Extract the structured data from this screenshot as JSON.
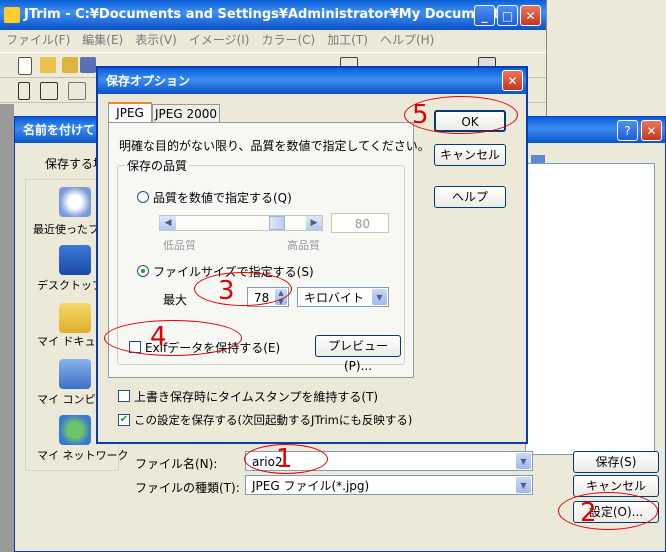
{
  "main_window": {
    "title": "JTrim - C:¥Documents and Settings¥Administrator¥My Document...",
    "menu": [
      "ファイル(F)",
      "編集(E)",
      "表示(V)",
      "イメージ(I)",
      "カラー(C)",
      "加工(T)",
      "ヘルプ(H)"
    ]
  },
  "save_as_dialog": {
    "title": "名前を付けて",
    "save_in_label": "保存する場",
    "places": [
      "最近使ったファ",
      "デスクトップ",
      "マイ ドキュメン",
      "マイ コンピュー",
      "マイ ネットワーク"
    ],
    "filename_label": "ファイル名(N):",
    "filename_value": "ario2",
    "filetype_label": "ファイルの種類(T):",
    "filetype_value": "JPEG ファイル(*.jpg)",
    "save_button": "保存(S)",
    "cancel_button": "キャンセル",
    "settings_button": "設定(O)..."
  },
  "options_dialog": {
    "title": "保存オプション",
    "tabs": [
      "JPEG",
      "JPEG 2000"
    ],
    "active_tab": "JPEG",
    "instruction": "明確な目的がない限り、品質を数値で指定してください。",
    "quality_group_label": "保存の品質",
    "radio_quality": "品質を数値で指定する(Q)",
    "quality_value": "80",
    "quality_slider_fraction": 0.8,
    "low_label": "低品質",
    "high_label": "高品質",
    "radio_filesize": "ファイルサイズで指定する(S)",
    "max_label": "最大",
    "max_value": "78",
    "unit_value": "キロバイト",
    "exif_label": "Exifデータを保持する(E)",
    "preview_button": "プレビュー(P)...",
    "timestamp_label": "上書き保存時にタイムスタンプを維持する(T)",
    "remember_label": "この設定を保存する(次回起動するJTrimにも反映する)",
    "ok_button": "OK",
    "cancel_button": "キャンセル",
    "help_button": "ヘルプ"
  },
  "annotations": {
    "n1": "1",
    "n2": "2",
    "n3": "3",
    "n4": "4",
    "n5": "5"
  },
  "colors": {
    "annotation_red": "#e00000",
    "titlebar_blue": "#0b5fd9",
    "dialog_bg": "#ece9d8"
  }
}
